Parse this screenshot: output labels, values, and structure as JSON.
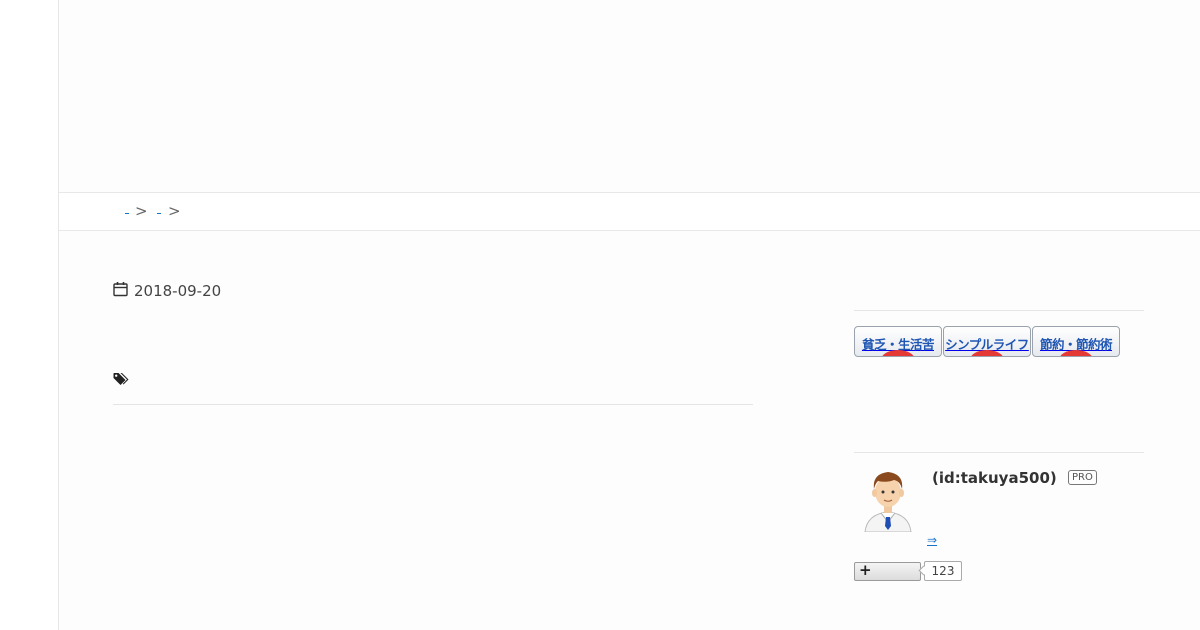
{
  "breadcrumb": {
    "links": [
      "",
      ""
    ],
    "separator": ">"
  },
  "article": {
    "date": "2018-09-20"
  },
  "sidebar": {
    "banners": [
      "貧乏・生活苦",
      "シンプルライフ",
      "節約・節約術"
    ],
    "profile": {
      "id_label": "(id:takuya500)",
      "badge": "PRO",
      "link_text": "⇒",
      "follow_count": "123"
    }
  },
  "icons": {
    "date": "calendar-icon",
    "tags": "tag-icon",
    "follow": "plus-icon"
  },
  "colors": {
    "link": "#1a73c9",
    "banner_text": "#1f56b4",
    "banner_dot": "#e53935"
  }
}
